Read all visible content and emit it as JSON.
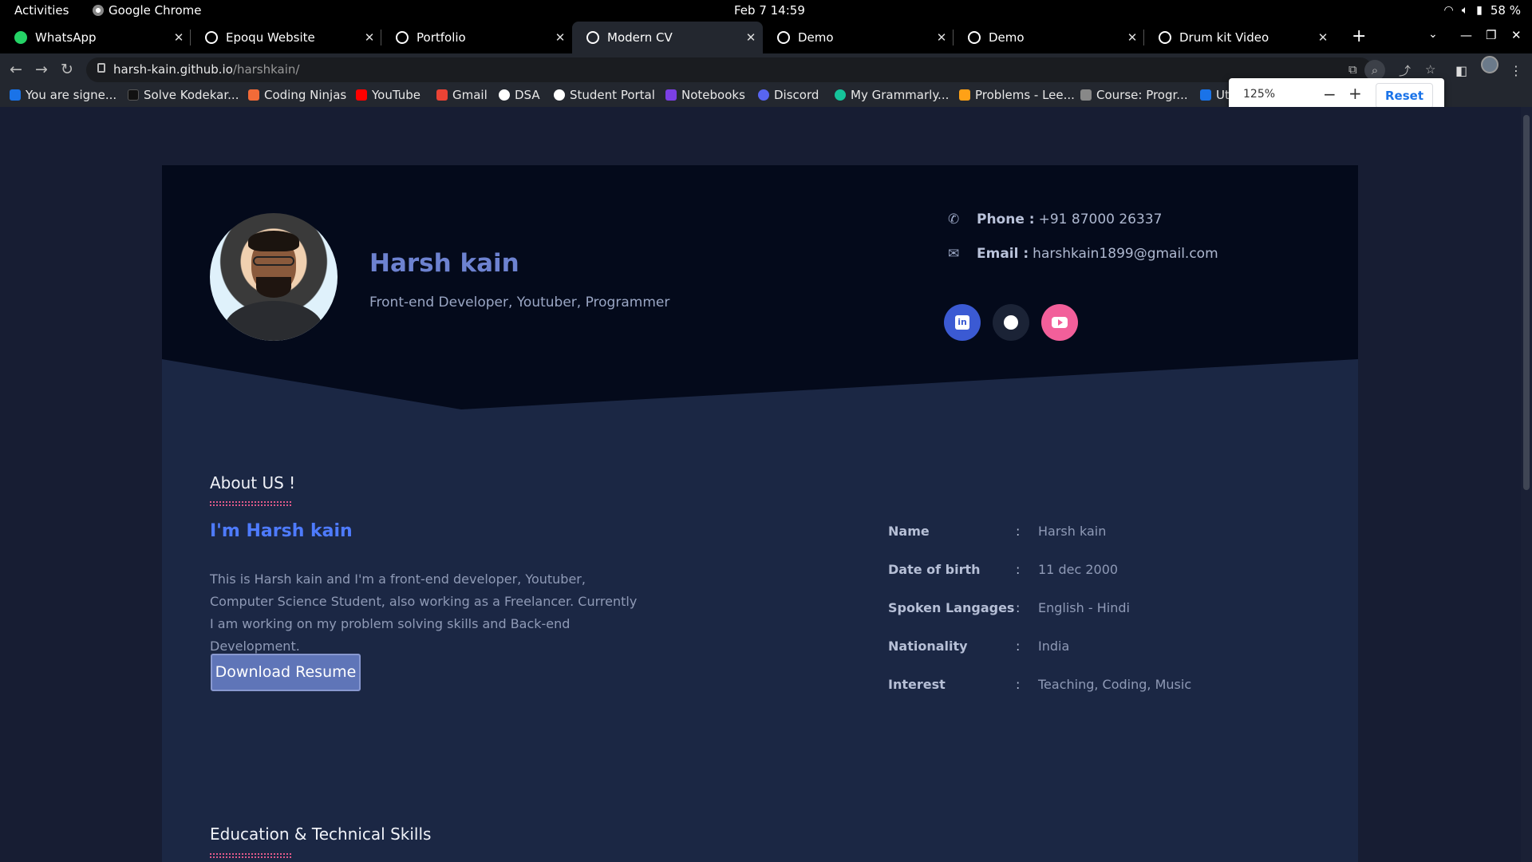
{
  "topbar": {
    "activities": "Activities",
    "app_name": "Google Chrome",
    "clock": "Feb 7  14:59",
    "battery": "58 %"
  },
  "tabs": [
    {
      "label": "WhatsApp"
    },
    {
      "label": "Epoqu Website"
    },
    {
      "label": "Portfolio"
    },
    {
      "label": "Modern CV"
    },
    {
      "label": "Demo"
    },
    {
      "label": "Demo"
    },
    {
      "label": "Drum kit Video"
    }
  ],
  "address": {
    "host": "harsh-kain.github.io",
    "path": "/harshkain/"
  },
  "bookmarks": [
    {
      "label": "You are signe...",
      "color": "#1a73e8"
    },
    {
      "label": "Solve Kodekar...",
      "color": "#111111"
    },
    {
      "label": "Coding Ninjas",
      "color": "#f26b38"
    },
    {
      "label": "YouTube",
      "color": "#ff0000"
    },
    {
      "label": "Gmail",
      "color": "#ea4335"
    },
    {
      "label": "DSA",
      "color": "#ffffff"
    },
    {
      "label": "Student Portal",
      "color": "#ffffff"
    },
    {
      "label": "Notebooks",
      "color": "#7b3fe4"
    },
    {
      "label": "Discord",
      "color": "#5865f2"
    },
    {
      "label": "My Grammarly...",
      "color": "#15c39a"
    },
    {
      "label": "Problems - Lee...",
      "color": "#ffa116"
    },
    {
      "label": "Course: Progr...",
      "color": "#888888"
    },
    {
      "label": "Ut",
      "color": "#1a73e8"
    }
  ],
  "zoom_popup": {
    "value": "125%",
    "minus": "−",
    "plus": "+",
    "reset": "Reset"
  },
  "profile": {
    "name": "Harsh kain",
    "role": "Front-end Developer, Youtuber, Programmer",
    "phone_label": "Phone :",
    "phone": "+91 87000 26337",
    "email_label": "Email :",
    "email": "harshkain1899@gmail.com"
  },
  "socials": [
    {
      "name": "linkedin-icon",
      "color": "#3b5ad3"
    },
    {
      "name": "github-icon",
      "color": "#1b2336"
    },
    {
      "name": "youtube-icon",
      "color": "#f25f9a"
    }
  ],
  "about": {
    "title": "About US !",
    "heading": "I'm Harsh kain",
    "text": "This is Harsh kain and I'm a front-end developer, Youtuber, Computer Science Student, also working as a Freelancer. Currently I am working on my problem solving skills and Back-end Development.",
    "button": "Download Resume",
    "info": [
      {
        "key": "Name",
        "value": "Harsh kain"
      },
      {
        "key": "Date of birth",
        "value": "11 dec 2000"
      },
      {
        "key": "Spoken Langages",
        "value": "English - Hindi"
      },
      {
        "key": "Nationality",
        "value": "India"
      },
      {
        "key": "Interest",
        "value": "Teaching, Coding, Music"
      }
    ]
  },
  "education": {
    "title": "Education & Technical Skills"
  },
  "colors": {
    "page_bg": "#171d33",
    "hero_bg": "#040a1b",
    "accent_blue": "#4e7bff",
    "name_blue": "#6d82d0",
    "underline_pink": "#e05a8a"
  }
}
